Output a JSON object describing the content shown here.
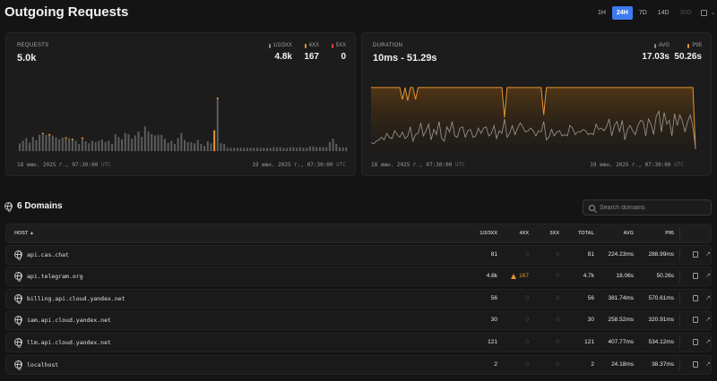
{
  "header": {
    "title": "Outgoing Requests",
    "ranges": [
      {
        "label": "1H",
        "state": "normal"
      },
      {
        "label": "24H",
        "state": "active"
      },
      {
        "label": "7D",
        "state": "normal"
      },
      {
        "label": "14D",
        "state": "normal"
      },
      {
        "label": "30D",
        "state": "disabled"
      }
    ]
  },
  "requests_panel": {
    "label": "REQUESTS",
    "value": "5.0k",
    "stats": [
      {
        "label": "1/2/3XX",
        "value": "4.8k",
        "color": "#8a8a8a"
      },
      {
        "label": "4XX",
        "value": "167",
        "color": "#e8932a"
      },
      {
        "label": "5XX",
        "value": "0",
        "color": "#e04a3a"
      }
    ],
    "start_time": "18 июн. 2025 г., 07:30:00",
    "end_time": "19 июн. 2025 г., 07:30:00",
    "tz": "UTC"
  },
  "duration_panel": {
    "label": "DURATION",
    "value": "10ms - 51.29s",
    "stats": [
      {
        "label": "AVG",
        "value": "17.03s",
        "color": "#8a8a8a"
      },
      {
        "label": "P95",
        "value": "50.26s",
        "color": "#e8932a"
      }
    ],
    "start_time": "18 июн. 2025 г., 07:30:00",
    "end_time": "19 июн. 2025 г., 07:30:00",
    "tz": "UTC"
  },
  "chart_data": [
    {
      "type": "bar",
      "series": [
        {
          "name": "1/2/3XX",
          "values": [
            12,
            16,
            20,
            13,
            22,
            17,
            25,
            26,
            25,
            24,
            24,
            21,
            18,
            21,
            19,
            20,
            17,
            16,
            11,
            19,
            15,
            12,
            16,
            14,
            16,
            18,
            14,
            16,
            11,
            26,
            22,
            18,
            28,
            26,
            19,
            24,
            30,
            22,
            38,
            30,
            26,
            24,
            25,
            25,
            19,
            13,
            16,
            11,
            20,
            28,
            17,
            14,
            14,
            12,
            17,
            11,
            8,
            15,
            12,
            15,
            80,
            12,
            11,
            5,
            5,
            5,
            5,
            5,
            5,
            5,
            5,
            5,
            5,
            5,
            5,
            5,
            5,
            6,
            6,
            6,
            5,
            5,
            6,
            6,
            5,
            6,
            5,
            5,
            7,
            7,
            6,
            6,
            6,
            6,
            14,
            19,
            11,
            6,
            6,
            6
          ]
        },
        {
          "name": "4XX",
          "values": [
            0,
            0,
            0,
            0,
            0,
            0,
            0,
            1,
            0,
            1,
            0,
            0,
            0,
            0,
            1,
            0,
            1,
            0,
            0,
            1,
            0,
            0,
            0,
            0,
            0,
            0,
            0,
            0,
            0,
            0,
            0,
            0,
            0,
            0,
            0,
            0,
            0,
            0,
            0,
            0,
            0,
            0,
            0,
            0,
            0,
            0,
            0,
            0,
            0,
            0,
            0,
            0,
            0,
            0,
            0,
            0,
            0,
            0,
            0,
            0,
            1,
            0,
            0,
            0,
            0,
            0,
            0,
            0,
            0,
            0,
            0,
            0,
            0,
            0,
            0,
            0,
            0,
            0,
            0,
            0,
            0,
            0,
            0,
            0,
            0,
            0,
            0,
            0,
            0,
            0,
            0,
            0,
            0,
            0,
            0,
            0,
            0,
            0,
            0,
            0
          ]
        },
        {
          "name": "4XX",
          "values": [
            0,
            0,
            0,
            0,
            0,
            0,
            0,
            0,
            0,
            0,
            0,
            0,
            0,
            0,
            0,
            0,
            0,
            0,
            0,
            0,
            0,
            0,
            0,
            0,
            0,
            0,
            0,
            0,
            0,
            0,
            0,
            0,
            0,
            0,
            0,
            0,
            0,
            0,
            0,
            0,
            0,
            0,
            0,
            0,
            0,
            0,
            0,
            0,
            0,
            0,
            0,
            0,
            0,
            0,
            0,
            0,
            0,
            0,
            0,
            0,
            0,
            0,
            0,
            0,
            0,
            0,
            0,
            0,
            0,
            0,
            0,
            0,
            0,
            0,
            0,
            0,
            0,
            0,
            0,
            0,
            0,
            0,
            0,
            0,
            0,
            0,
            0,
            0,
            0,
            0,
            0,
            0,
            0,
            0,
            0,
            0,
            0,
            0,
            0,
            0
          ]
        },
        {
          "name": "5XX",
          "values": [
            0,
            0,
            0,
            0,
            0,
            0,
            0,
            0,
            0,
            0,
            0,
            0,
            0,
            0,
            0,
            0,
            0,
            0,
            0,
            0,
            0,
            0,
            0,
            0,
            0,
            0,
            0,
            0,
            0,
            0,
            0,
            0,
            0,
            0,
            0,
            0,
            0,
            0,
            0,
            0,
            0,
            0,
            0,
            0,
            0,
            0,
            0,
            0,
            0,
            0,
            0,
            0,
            0,
            0,
            0,
            0,
            0,
            0,
            0,
            0,
            0,
            0,
            0,
            0,
            0,
            0,
            0,
            0,
            0,
            0,
            0,
            0,
            0,
            0,
            0,
            0,
            0,
            0,
            0,
            0,
            0,
            0,
            0,
            0,
            0,
            0,
            0,
            0,
            0,
            0,
            0,
            0,
            0,
            0,
            0,
            0,
            0,
            0,
            0,
            0
          ]
        }
      ],
      "highlight_bar": {
        "index": 59,
        "value": 32,
        "series": "4XX"
      },
      "ylim": [
        0,
        85
      ]
    },
    {
      "type": "line",
      "series": [
        {
          "name": "P95",
          "values": [
            50,
            50,
            50,
            50,
            50,
            50,
            50,
            50,
            50,
            50,
            50,
            50,
            41,
            50,
            40,
            50,
            50,
            41,
            50,
            50,
            50,
            50,
            50,
            50,
            50,
            50,
            50,
            50,
            50,
            50,
            50,
            50,
            50,
            50,
            50,
            50,
            50,
            50,
            50,
            50,
            50,
            50,
            50,
            50,
            50,
            50,
            50,
            50,
            50,
            50,
            50,
            27,
            50,
            50,
            50,
            50,
            50,
            50,
            50,
            50,
            50,
            50,
            50,
            50,
            50,
            50,
            29,
            50,
            50,
            50,
            50,
            50,
            50,
            50,
            50,
            50,
            50,
            50,
            50,
            50,
            50,
            50,
            50,
            50,
            50,
            50,
            50,
            50,
            50,
            50,
            50,
            50,
            50,
            50,
            50,
            50,
            50,
            50,
            50,
            50,
            50,
            50,
            50,
            50,
            50,
            50,
            50,
            50,
            50,
            50,
            50,
            50,
            50,
            50,
            50,
            50,
            50,
            50,
            50,
            50,
            50,
            50,
            50,
            50,
            3
          ]
        },
        {
          "name": "AVG",
          "values": [
            8,
            7,
            9,
            10,
            12,
            10,
            15,
            12,
            11,
            17,
            14,
            12,
            16,
            11,
            13,
            20,
            9,
            14,
            15,
            23,
            13,
            17,
            22,
            10,
            18,
            14,
            24,
            11,
            9,
            20,
            16,
            24,
            13,
            12,
            19,
            20,
            12,
            17,
            18,
            12,
            13,
            19,
            15,
            19,
            20,
            13,
            15,
            21,
            11,
            17,
            15,
            26,
            12,
            15,
            21,
            14,
            19,
            23,
            20,
            16,
            17,
            19,
            17,
            13,
            17,
            16,
            24,
            10,
            12,
            18,
            13,
            16,
            17,
            13,
            14,
            13,
            21,
            19,
            14,
            16,
            16,
            18,
            17,
            14,
            15,
            14,
            22,
            18,
            19,
            17,
            20,
            26,
            13,
            21,
            24,
            16,
            25,
            10,
            18,
            21,
            17,
            14,
            21,
            25,
            24,
            13,
            26,
            22,
            14,
            28,
            32,
            16,
            31,
            22,
            25,
            13,
            30,
            21,
            29,
            24,
            16,
            24,
            29,
            20,
            4
          ]
        }
      ],
      "ylim": [
        0,
        52
      ]
    }
  ],
  "domains": {
    "title": "6 Domains",
    "search_placeholder": "Search domains",
    "columns": {
      "host": "HOST ▲",
      "ok": "1/2/3XX",
      "c4xx": "4XX",
      "c5xx": "5XX",
      "total": "TOTAL",
      "avg": "AVG",
      "p95": "P95"
    },
    "rows": [
      {
        "host": "api.cas.chat",
        "ok": "81",
        "c4xx": "0",
        "c5xx": "0",
        "total": "81",
        "avg": "224.23ms",
        "p95": "288.99ms"
      },
      {
        "host": "api.telegram.org",
        "ok": "4.8k",
        "c4xx": "167",
        "c5xx": "0",
        "total": "4.7k",
        "avg": "18.06s",
        "p95": "50.26s"
      },
      {
        "host": "billing.api.cloud.yandex.net",
        "ok": "56",
        "c4xx": "0",
        "c5xx": "0",
        "total": "56",
        "avg": "381.74ms",
        "p95": "570.61ms"
      },
      {
        "host": "iam.api.cloud.yandex.net",
        "ok": "30",
        "c4xx": "0",
        "c5xx": "0",
        "total": "30",
        "avg": "258.52ms",
        "p95": "320.91ms"
      },
      {
        "host": "llm.api.cloud.yandex.net",
        "ok": "121",
        "c4xx": "0",
        "c5xx": "0",
        "total": "121",
        "avg": "407.77ms",
        "p95": "534.12ms"
      },
      {
        "host": "localhost",
        "ok": "2",
        "c4xx": "0",
        "c5xx": "0",
        "total": "2",
        "avg": "24.18ms",
        "p95": "38.37ms"
      }
    ]
  },
  "colors": {
    "accent": "#3d7cf0",
    "warn": "#e8932a",
    "error": "#e04a3a",
    "neutral": "#5c5c5c"
  }
}
